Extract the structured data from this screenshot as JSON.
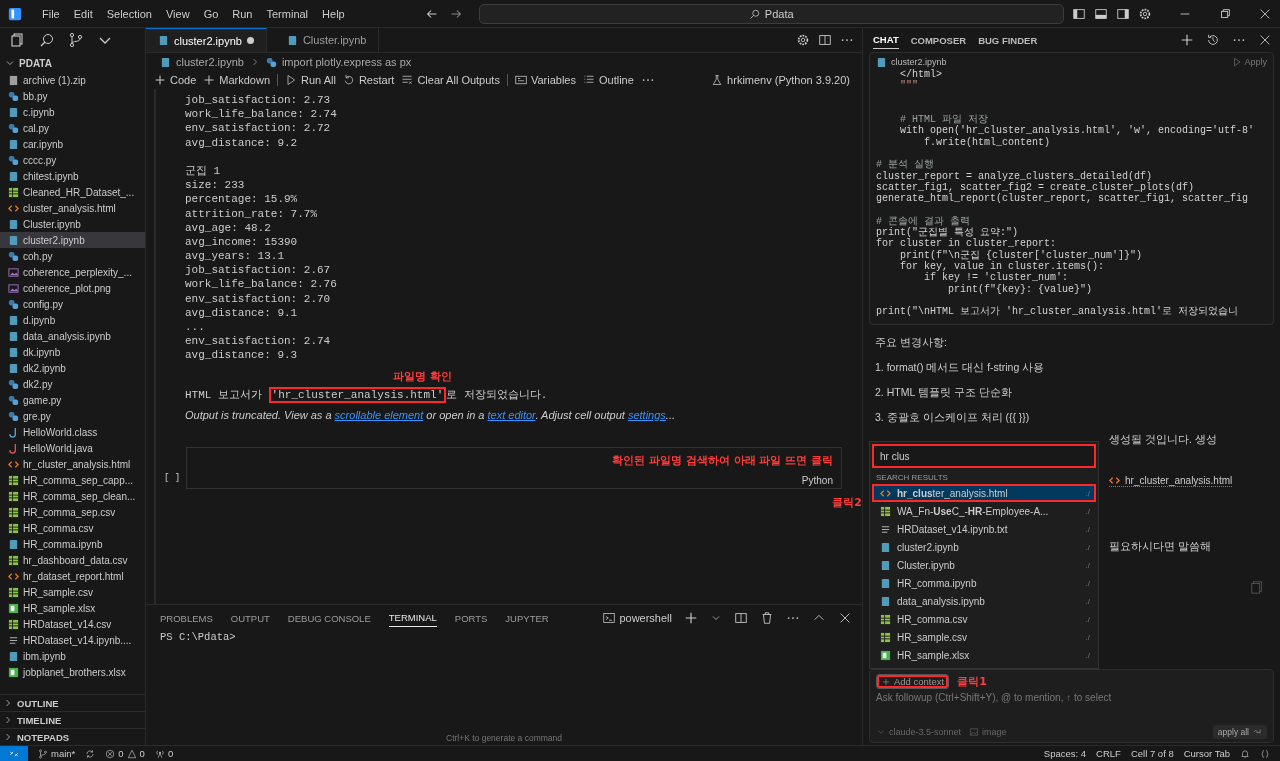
{
  "title_bar": {
    "menus": [
      "File",
      "Edit",
      "Selection",
      "View",
      "Go",
      "Run",
      "Terminal",
      "Help"
    ],
    "search": "Pdata"
  },
  "explorer": {
    "title": "PDATA",
    "files": [
      {
        "name": "archive (1).zip",
        "kind": "zip",
        "selected": false
      },
      {
        "name": "bb.py",
        "kind": "py",
        "selected": false
      },
      {
        "name": "c.ipynb",
        "kind": "notebook",
        "selected": false
      },
      {
        "name": "cal.py",
        "kind": "py",
        "selected": false
      },
      {
        "name": "car.ipynb",
        "kind": "notebook",
        "selected": false
      },
      {
        "name": "cccc.py",
        "kind": "py",
        "selected": false
      },
      {
        "name": "chitest.ipynb",
        "kind": "notebook",
        "selected": false
      },
      {
        "name": "Cleaned_HR_Dataset_...",
        "kind": "csv",
        "selected": false
      },
      {
        "name": "cluster_analysis.html",
        "kind": "html",
        "selected": false
      },
      {
        "name": "Cluster.ipynb",
        "kind": "notebook",
        "selected": false
      },
      {
        "name": "cluster2.ipynb",
        "kind": "notebook",
        "selected": true
      },
      {
        "name": "coh.py",
        "kind": "py",
        "selected": false
      },
      {
        "name": "coherence_perplexity_...",
        "kind": "image",
        "selected": false
      },
      {
        "name": "coherence_plot.png",
        "kind": "image",
        "selected": false
      },
      {
        "name": "config.py",
        "kind": "py",
        "selected": false
      },
      {
        "name": "d.ipynb",
        "kind": "notebook",
        "selected": false
      },
      {
        "name": "data_analysis.ipynb",
        "kind": "notebook",
        "selected": false
      },
      {
        "name": "dk.ipynb",
        "kind": "notebook",
        "selected": false
      },
      {
        "name": "dk2.ipynb",
        "kind": "notebook",
        "selected": false
      },
      {
        "name": "dk2.py",
        "kind": "py",
        "selected": false
      },
      {
        "name": "game.py",
        "kind": "py",
        "selected": false
      },
      {
        "name": "gre.py",
        "kind": "py",
        "selected": false
      },
      {
        "name": "HelloWorld.class",
        "kind": "class",
        "selected": false
      },
      {
        "name": "HelloWorld.java",
        "kind": "java",
        "selected": false
      },
      {
        "name": "hr_cluster_analysis.html",
        "kind": "html",
        "selected": false
      },
      {
        "name": "HR_comma_sep_capp...",
        "kind": "csv",
        "selected": false
      },
      {
        "name": "HR_comma_sep_clean...",
        "kind": "csv",
        "selected": false
      },
      {
        "name": "HR_comma_sep.csv",
        "kind": "csv",
        "selected": false
      },
      {
        "name": "HR_comma.csv",
        "kind": "csv",
        "selected": false
      },
      {
        "name": "HR_comma.ipynb",
        "kind": "notebook",
        "selected": false
      },
      {
        "name": "hr_dashboard_data.csv",
        "kind": "csv",
        "selected": false
      },
      {
        "name": "hr_dataset_report.html",
        "kind": "html",
        "selected": false
      },
      {
        "name": "HR_sample.csv",
        "kind": "csv",
        "selected": false
      },
      {
        "name": "HR_sample.xlsx",
        "kind": "xlsx",
        "selected": false
      },
      {
        "name": "HRDataset_v14.csv",
        "kind": "csv",
        "selected": false
      },
      {
        "name": "HRDataset_v14.ipynb....",
        "kind": "text",
        "selected": false
      },
      {
        "name": "ibm.ipynb",
        "kind": "notebook",
        "selected": false
      },
      {
        "name": "jobplanet_brothers.xlsx",
        "kind": "xlsx",
        "selected": false
      }
    ],
    "sections": [
      "OUTLINE",
      "TIMELINE",
      "NOTEPADS"
    ]
  },
  "editor": {
    "tabs": [
      {
        "label": "cluster2.ipynb",
        "selected": true,
        "modified": true
      },
      {
        "label": "Cluster.ipynb",
        "selected": false,
        "modified": false
      }
    ],
    "breadcrumb": [
      "cluster2.ipynb",
      "import plotly.express as px"
    ],
    "toolbar": [
      {
        "label": "Code",
        "kind": "add"
      },
      {
        "label": "Markdown",
        "kind": "add"
      },
      {
        "label": "Run All",
        "kind": "run"
      },
      {
        "label": "Restart",
        "kind": "restart"
      },
      {
        "label": "Clear All Outputs",
        "kind": "clear"
      },
      {
        "label": "Variables",
        "kind": "variables"
      },
      {
        "label": "Outline",
        "kind": "outline"
      }
    ],
    "kernel": "hrkimenv (Python 3.9.20)",
    "output_lines": [
      "job_satisfaction: 2.73",
      "work_life_balance: 2.74",
      "env_satisfaction: 2.72",
      "avg_distance: 9.2"
    ],
    "output_lines_2": [
      "군집 1",
      "size: 233",
      "percentage: 15.9%",
      "attrition_rate: 7.7%",
      "avg_age: 48.2",
      "avg_income: 15390",
      "avg_years: 13.1",
      "job_satisfaction: 2.67",
      "work_life_balance: 2.76",
      "env_satisfaction: 2.70",
      "avg_distance: 9.1",
      "...",
      "env_satisfaction: 2.74",
      "avg_distance: 9.3"
    ],
    "note_1": "파일명 확인",
    "saved_message": {
      "before": "HTML 보고서가 ",
      "file": "'hr_cluster_analysis.html'",
      "after": "로 저장되었습니다.",
      "marked": true
    },
    "truncation_note": [
      {
        "text": "Output is truncated. View as a ",
        "link": false
      },
      {
        "text": "scrollable element",
        "link": true
      },
      {
        "text": " or open in a ",
        "link": false
      },
      {
        "text": "text editor",
        "link": true
      },
      {
        "text": ". Adjust cell output ",
        "link": false
      },
      {
        "text": "settings",
        "link": true
      },
      {
        "text": "...",
        "link": false
      }
    ],
    "empty_cell": {
      "prompt": "[ ]",
      "language": "Python",
      "note": "확인된 파일명 검색하여 아래 파일 뜨면 클릭"
    },
    "note_2": "클릭2"
  },
  "panel": {
    "tabs": [
      {
        "label": "PROBLEMS",
        "selected": false
      },
      {
        "label": "OUTPUT",
        "selected": false
      },
      {
        "label": "DEBUG CONSOLE",
        "selected": false
      },
      {
        "label": "TERMINAL",
        "selected": true
      },
      {
        "label": "PORTS",
        "selected": false
      },
      {
        "label": "JUPYTER",
        "selected": false
      }
    ],
    "shell": "powershell",
    "prompt": "PS C:\\Pdata>",
    "hint": "Ctrl+K to generate a command"
  },
  "chat": {
    "tabs": [
      {
        "label": "CHAT",
        "selected": true
      },
      {
        "label": "COMPOSER",
        "selected": false
      },
      {
        "label": "BUG FINDER",
        "selected": false
      }
    ],
    "code_block": {
      "file": "cluster2.ipynb",
      "action": "Apply",
      "lines": [
        {
          "kind": "code",
          "text": "    </html>"
        },
        {
          "kind": "string",
          "text": "    \"\"\""
        },
        {
          "kind": "blank"
        },
        {
          "kind": "blank"
        },
        {
          "kind": "comment",
          "text": "    # HTML 파일 저장"
        },
        {
          "kind": "code",
          "text": "    with open('hr_cluster_analysis.html', 'w', encoding='utf-8'"
        },
        {
          "kind": "code",
          "text": "        f.write(html_content)"
        },
        {
          "kind": "blank"
        },
        {
          "kind": "comment",
          "text": "# 분석 실행"
        },
        {
          "kind": "code",
          "text": "cluster_report = analyze_clusters_detailed(df)"
        },
        {
          "kind": "code",
          "text": "scatter_fig1, scatter_fig2 = create_cluster_plots(df)"
        },
        {
          "kind": "code",
          "text": "generate_html_report(cluster_report, scatter_fig1, scatter_fig"
        },
        {
          "kind": "blank"
        },
        {
          "kind": "comment",
          "text": "# 콘솔에 결과 출력"
        },
        {
          "kind": "code",
          "text": "print(\"군집별 특성 요약:\")"
        },
        {
          "kind": "code",
          "text": "for cluster in cluster_report:"
        },
        {
          "kind": "code",
          "text": "    print(f\"\\n군집 {cluster['cluster_num']}\")"
        },
        {
          "kind": "code",
          "text": "    for key, value in cluster.items():"
        },
        {
          "kind": "code",
          "text": "        if key != 'cluster_num':"
        },
        {
          "kind": "code",
          "text": "            print(f\"{key}: {value}\")"
        },
        {
          "kind": "blank"
        },
        {
          "kind": "code",
          "text": "print(\"\\nHTML 보고서가 'hr_cluster_analysis.html'로 저장되었습니"
        }
      ]
    },
    "heading": "주요 변경사항:",
    "changes": [
      "1. format() 메서드 대신 f-string 사용",
      "2. HTML 템플릿 구조 단순화",
      "3. 중괄호 이스케이프 처리 ({{ }})"
    ],
    "covered_line_1": "생성될 것입니다. 생성",
    "context_chip": "hr_cluster_analysis.html",
    "covered_line_2": "필요하시다면 말씀해",
    "picker": {
      "query": "hr clus",
      "marked": true,
      "heading": "SEARCH RESULTS",
      "results": [
        {
          "name": "**hr_clus**ter_analysis.html",
          "kind": "html",
          "path": "./",
          "selected": true,
          "marked": true
        },
        {
          "name": "WA_Fn-**Use**C_-**HR**-Employee-A...",
          "kind": "csv",
          "path": "./",
          "selected": false,
          "marked": false
        },
        {
          "name": "HRDataset_v14.ipynb.txt",
          "kind": "text",
          "path": "./",
          "selected": false,
          "marked": false
        },
        {
          "name": "cluster2.ipynb",
          "kind": "notebook",
          "path": "./",
          "selected": false,
          "marked": false
        },
        {
          "name": "Cluster.ipynb",
          "kind": "notebook",
          "path": "./",
          "selected": false,
          "marked": false
        },
        {
          "name": "HR_comma.ipynb",
          "kind": "notebook",
          "path": "./",
          "selected": false,
          "marked": false
        },
        {
          "name": "data_analysis.ipynb",
          "kind": "notebook",
          "path": "./",
          "selected": false,
          "marked": false
        },
        {
          "name": "HR_comma.csv",
          "kind": "csv",
          "path": "./",
          "selected": false,
          "marked": false
        },
        {
          "name": "HR_sample.csv",
          "kind": "csv",
          "path": "./",
          "selected": false,
          "marked": false
        },
        {
          "name": "HR_sample.xlsx",
          "kind": "xlsx",
          "path": "./",
          "selected": false,
          "marked": false
        }
      ]
    },
    "composer": {
      "add_context": "Add context",
      "add_context_marked": true,
      "note": "클릭1",
      "placeholder": "Ask followup (Ctrl+Shift+Y), @ to mention, ↑ to select",
      "model": "claude-3.5-sonnet",
      "image": "image",
      "apply_all": "apply all"
    }
  },
  "status_bar": {
    "branch": "main*",
    "errors": "0",
    "warnings": "0",
    "ports": "0",
    "right": [
      "Spaces: 4",
      "CRLF",
      "Cell 7 of 8",
      "Cursor Tab"
    ]
  }
}
